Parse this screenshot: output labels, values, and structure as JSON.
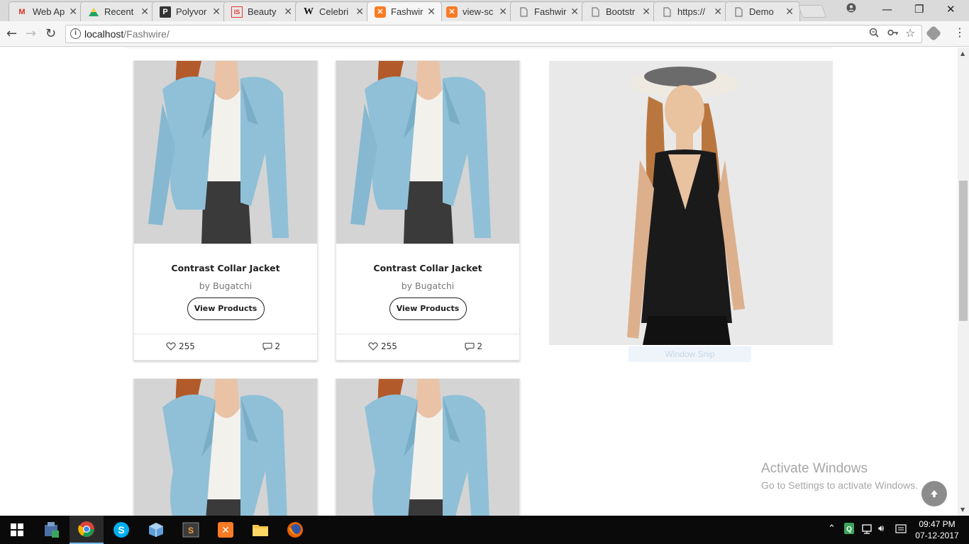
{
  "browser": {
    "tabs": [
      {
        "title": "Web Ap",
        "icon": "gmail-icon",
        "color": "#d93025",
        "active": false
      },
      {
        "title": "Recent",
        "icon": "drive-icon",
        "color": "#1fa463",
        "active": false
      },
      {
        "title": "Polyvor",
        "icon": "polyvore-icon",
        "color": "#333333",
        "active": false
      },
      {
        "title": "Beauty",
        "icon": "is-icon",
        "color": "#e53935",
        "active": false
      },
      {
        "title": "Celebri",
        "icon": "wikipedia-icon",
        "color": "#111111",
        "active": false
      },
      {
        "title": "Fashwir",
        "icon": "xampp-icon",
        "color": "#fb7a24",
        "active": true
      },
      {
        "title": "view-sc",
        "icon": "xampp-icon",
        "color": "#fb7a24",
        "active": false
      },
      {
        "title": "Fashwir",
        "icon": "page-icon",
        "color": "#777777",
        "active": false
      },
      {
        "title": "Bootstr",
        "icon": "page-icon",
        "color": "#777777",
        "active": false
      },
      {
        "title": "https://",
        "icon": "page-icon",
        "color": "#777777",
        "active": false
      },
      {
        "title": "Demo",
        "icon": "page-icon",
        "color": "#777777",
        "active": false
      }
    ],
    "url_host": "localhost",
    "url_path": "/Fashwire/"
  },
  "products": [
    {
      "title": "Contrast Collar Jacket",
      "brand": "by Bugatchi",
      "button": "View Products",
      "likes": "255",
      "comments": "2"
    },
    {
      "title": "Contrast Collar Jacket",
      "brand": "by Bugatchi",
      "button": "View Products",
      "likes": "255",
      "comments": "2"
    },
    {
      "title": "",
      "brand": "",
      "button": "",
      "likes": "",
      "comments": ""
    },
    {
      "title": "",
      "brand": "",
      "button": "",
      "likes": "",
      "comments": ""
    }
  ],
  "snip_label": "Window Snip",
  "watermark": {
    "line1": "Activate Windows",
    "line2": "Go to Settings to activate Windows."
  },
  "taskbar": {
    "time": "09:47 PM",
    "date": "07-12-2017"
  },
  "colors": {
    "jacket": "#8fc0d8",
    "top_black": "#1a1a1a",
    "hair": "#b35a2a",
    "accent": "#76b9ed"
  }
}
